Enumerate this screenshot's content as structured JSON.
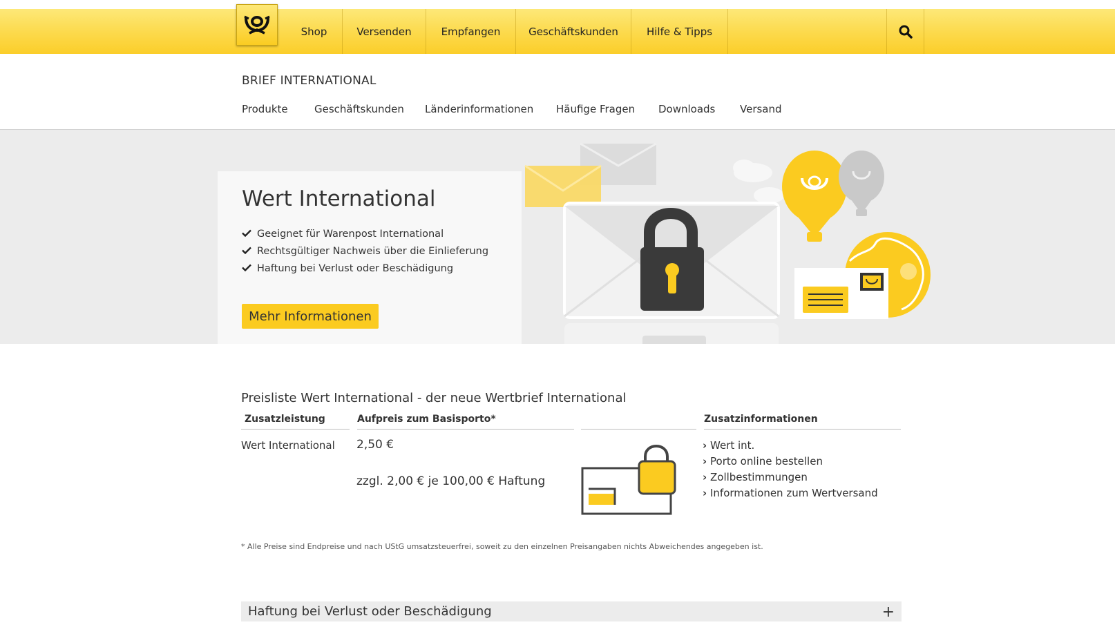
{
  "topnav": {
    "items": [
      "Shop",
      "Versenden",
      "Empfangen",
      "Geschäftskunden",
      "Hilfe & Tipps"
    ],
    "logo_icon": "posthorn-icon",
    "search_icon": "search-icon"
  },
  "section": {
    "title": "BRIEF INTERNATIONAL",
    "subnav": [
      "Produkte",
      "Geschäftskunden",
      "Länderinformationen",
      "Häufige Fragen",
      "Downloads",
      "Versand"
    ]
  },
  "hero": {
    "title": "Wert International",
    "bullets": [
      "Geeignet für Warenpost International",
      "Rechtsgültiger Nachweis über die Einlieferung",
      "Haftung bei Verlust oder Beschädigung"
    ],
    "button_label": "Mehr Informationen"
  },
  "pricelist": {
    "heading": "Preisliste Wert International - der neue Wertbrief International",
    "headers": {
      "service": "Zusatzleistung",
      "surcharge": "Aufpreis zum Basisporto*",
      "info": "Zusatzinformationen"
    },
    "row": {
      "service": "Wert International",
      "price": "2,50 €",
      "liability": "zzgl. 2,00 € je 100,00 € Haftung"
    },
    "links": [
      "Wert int.",
      "Porto online bestellen",
      "Zollbestimmungen",
      "Informationen zum Wertversand"
    ],
    "footnote": "* Alle Preise sind Endpreise und nach UStG umsatzsteuerfrei, soweit zu den einzelnen Preisangaben nichts Abweichendes angegeben ist."
  },
  "accordion": {
    "label": "Haftung bei Verlust oder Beschädigung"
  },
  "colors": {
    "brand_yellow": "#fbcb20",
    "hero_bg": "#ececec",
    "text": "#323232"
  }
}
